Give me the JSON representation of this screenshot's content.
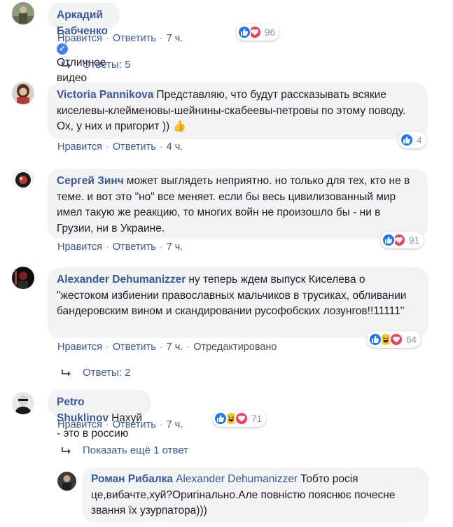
{
  "comments": [
    {
      "author": "Аркадий Бабченко",
      "verified": true,
      "text": "Отличное видео",
      "like": "Нравится",
      "reply": "Ответить",
      "time": "7 ч.",
      "reactions": [
        "like",
        "love"
      ],
      "reaction_count": "96"
    },
    {
      "author": "Victoria Pannikova",
      "text": "Представляю, что будут рассказывать всякие киселевы-клейменовы-шейнины-скабеевы-петровы по этому поводу. Ох, у них и пригорит ))",
      "emoji": "👍",
      "like": "Нравится",
      "reply": "Ответить",
      "time": "4 ч.",
      "reactions": [
        "like"
      ],
      "reaction_count": "4"
    },
    {
      "author": "Сергей Зинч",
      "text": "может выглядеть неприятно. но только для тех, кто не в теме. и вот это \"но\" все меняет. если бы весь цивилизованный мир имел такую же реакцию, то многих войн не произошло бы - ни в Грузии, ни в Украине.",
      "like": "Нравится",
      "reply": "Ответить",
      "time": "7 ч.",
      "reactions": [
        "like",
        "love"
      ],
      "reaction_count": "91"
    },
    {
      "author": "Alexander Dehumanizzer",
      "text": "ну теперь ждем выпуск Киселева о \"жестоком избиении православных мальчиков в трусиках, обливании бандеровским вином и скандировании русофобских лозунгов!!11111\"",
      "like": "Нравится",
      "reply": "Ответить",
      "time": "7 ч.",
      "edited": "Отредактировано",
      "reactions": [
        "like",
        "haha",
        "love"
      ],
      "reaction_count": "64"
    },
    {
      "author": "Petro Shuklinov",
      "text": "Нахуй - это в россию",
      "like": "Нравится",
      "reply": "Ответить",
      "time": "7 ч.",
      "reactions": [
        "like",
        "haha",
        "love"
      ],
      "reaction_count": "71"
    },
    {
      "author": "Роман Рибалка",
      "reply_to": "Alexander Dehumanizzer",
      "text": "Тобто росія це,вибачте,хуй?Оригінально.Але повністю пояснює почесне звання їх узурпатора)))"
    }
  ],
  "replies": [
    {
      "label": "Ответы: 5"
    },
    {
      "label": "Ответы: 2"
    },
    {
      "label": "Показать ещё 1 ответ"
    }
  ],
  "colors": {
    "author": "#385898",
    "bubble": "#f2f3f5",
    "meta": "#4b4f56",
    "like": "#1877f2",
    "love": "#f33e58",
    "haha": "#f7c530"
  }
}
